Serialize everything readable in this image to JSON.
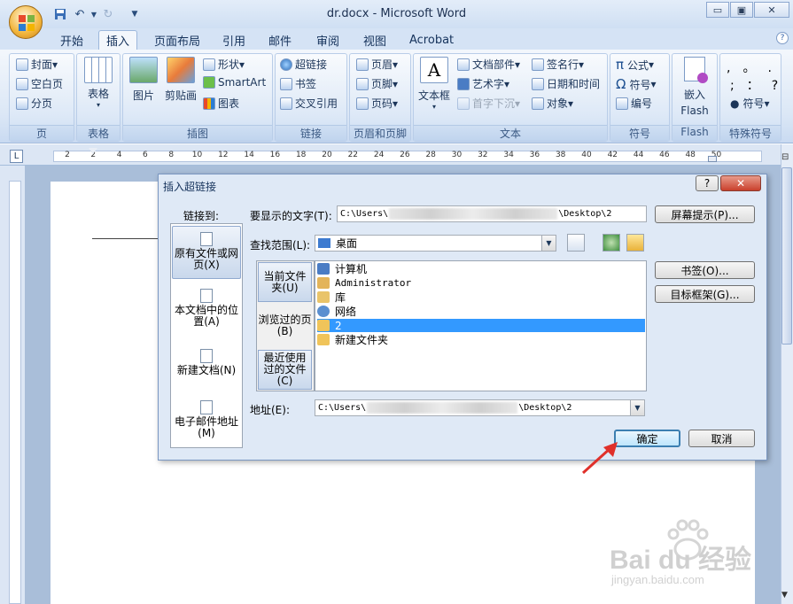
{
  "window": {
    "title": "dr.docx - Microsoft Word"
  },
  "quick_access": {
    "save": "save-icon",
    "undo": "undo-icon",
    "redo": "redo-icon",
    "more": "▼"
  },
  "window_buttons": {
    "minimize": "▭",
    "restore": "▣",
    "close": "✕"
  },
  "tabs": [
    "开始",
    "插入",
    "页面布局",
    "引用",
    "邮件",
    "审阅",
    "视图",
    "Acrobat"
  ],
  "active_tab": "插入",
  "ribbon": {
    "groups": [
      {
        "label": "页",
        "items": [
          "封面",
          "空白页",
          "分页"
        ]
      },
      {
        "label": "表格",
        "items": [
          "表格"
        ]
      },
      {
        "label": "插图",
        "items": [
          "图片",
          "剪贴画",
          "形状",
          "SmartArt",
          "图表"
        ]
      },
      {
        "label": "链接",
        "items": [
          "超链接",
          "书签",
          "交叉引用"
        ]
      },
      {
        "label": "页眉和页脚",
        "items": [
          "页眉",
          "页脚",
          "页码"
        ]
      },
      {
        "label": "文本",
        "items": [
          "文本框",
          "文档部件",
          "艺术字",
          "首字下沉",
          "签名行",
          "日期和时间",
          "对象"
        ]
      },
      {
        "label": "符号",
        "items": [
          "公式",
          "符号",
          "编号"
        ]
      },
      {
        "label": "Flash",
        "items": [
          "嵌入",
          "Flash"
        ]
      },
      {
        "label": "特殊符号",
        "items": [
          "符号"
        ]
      }
    ]
  },
  "ruler": {
    "numbers": [
      "2",
      "2",
      "4",
      "6",
      "8",
      "10",
      "12",
      "14",
      "16",
      "18",
      "20",
      "22",
      "24",
      "26",
      "28",
      "30",
      "32",
      "34",
      "36",
      "38",
      "40",
      "42",
      "44",
      "46",
      "48",
      "50"
    ]
  },
  "dialog": {
    "title": "插入超链接",
    "help": "?",
    "close": "✕",
    "link_to_label": "链接到:",
    "nav": [
      "原有文件或网页(X)",
      "本文档中的位置(A)",
      "新建文档(N)",
      "电子邮件地址(M)"
    ],
    "display_text_label": "要显示的文字(T):",
    "display_text_prefix": "C:\\Users\\",
    "display_text_suffix": "\\Desktop\\2",
    "screentip_button": "屏幕提示(P)...",
    "lookin_label": "查找范围(L):",
    "lookin_value": "桌面",
    "sub_nav": [
      "当前文件夹(U)",
      "浏览过的页(B)",
      "最近使用过的文件(C)"
    ],
    "files": [
      "计算机",
      "Administrator",
      "库",
      "网络",
      "2",
      "新建文件夹"
    ],
    "selected_file": "2",
    "bookmark_button": "书签(O)...",
    "target_frame_button": "目标框架(G)...",
    "address_label": "地址(E):",
    "address_prefix": "C:\\Users\\",
    "address_suffix": "\\Desktop\\2",
    "ok": "确定",
    "cancel": "取消"
  },
  "watermark": {
    "brand": "Bai du 经验",
    "url": "jingyan.baidu.com"
  },
  "colors": {
    "accent": "#3399ff",
    "arrow": "#e0302a",
    "ribbon": "#dbe7f6"
  }
}
